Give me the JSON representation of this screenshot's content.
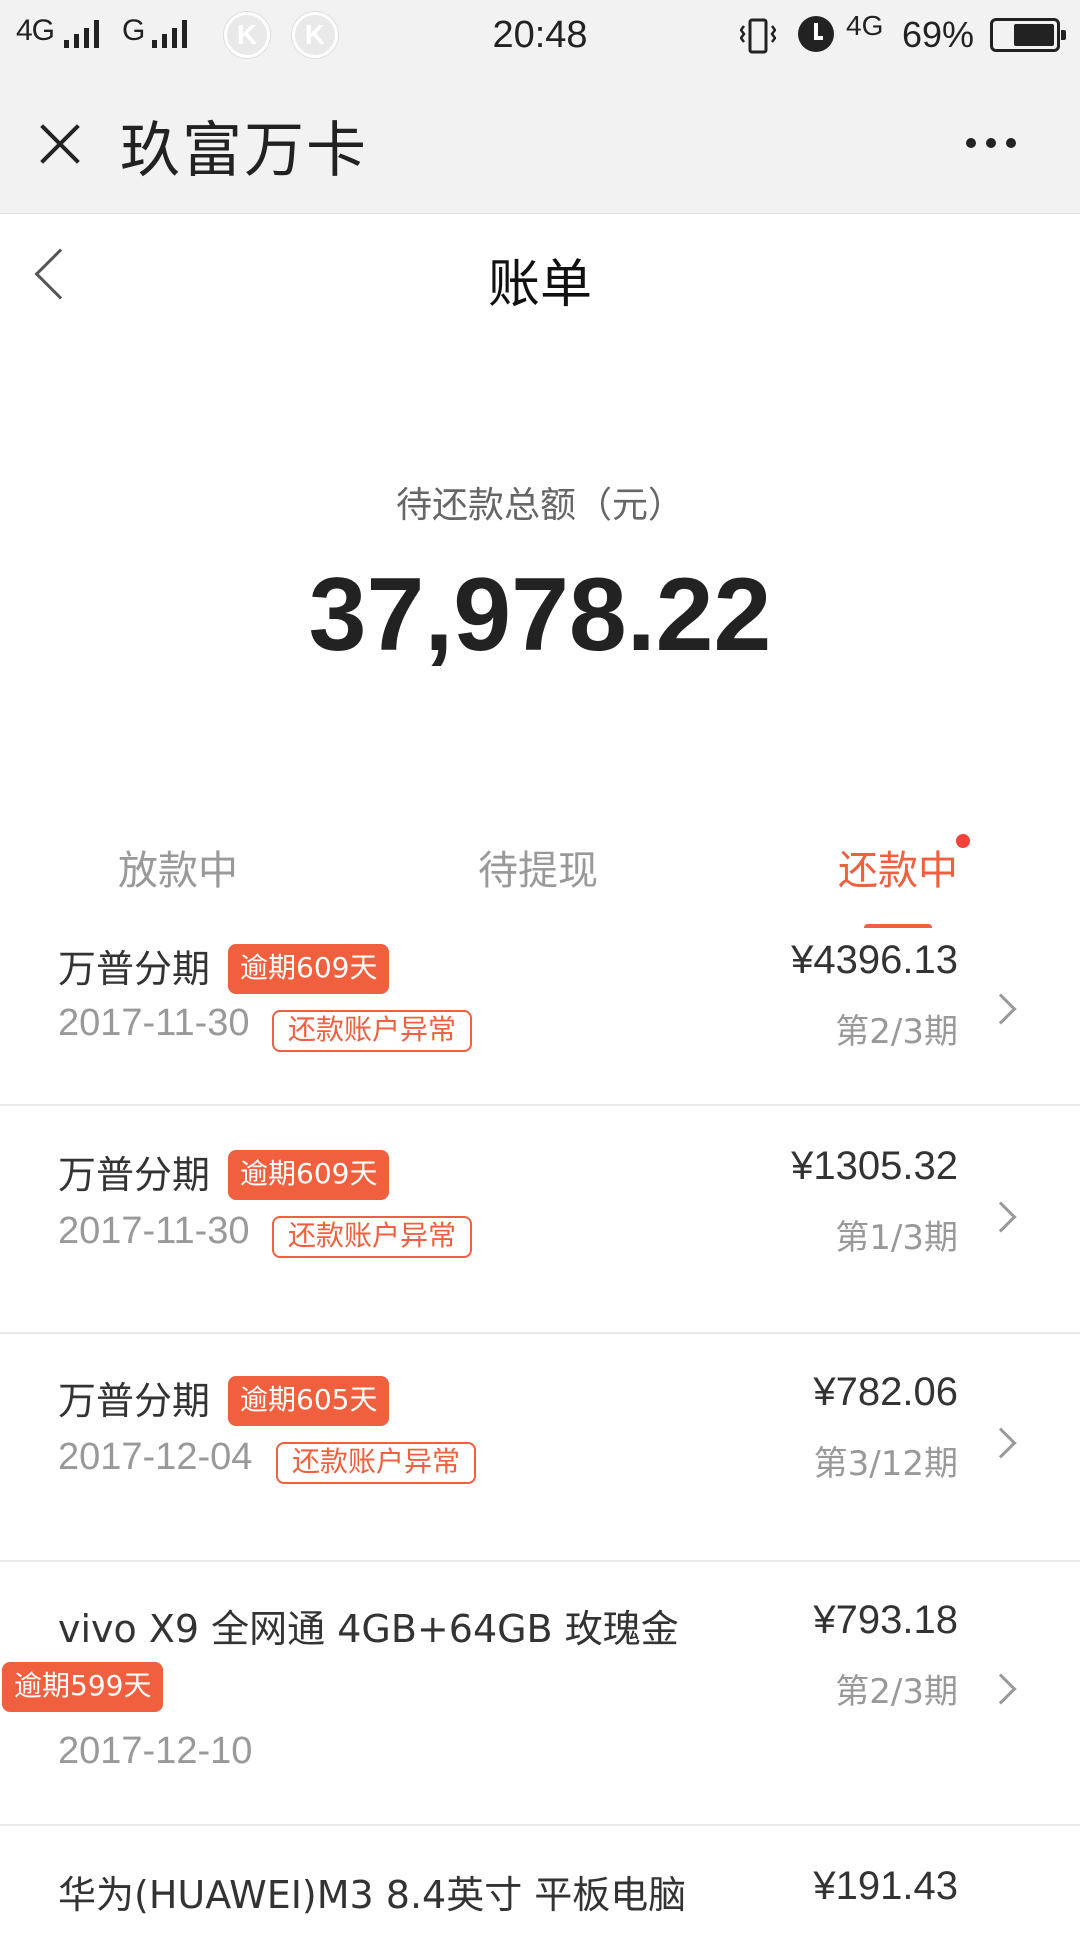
{
  "status_bar": {
    "network1": "4G",
    "network2": "G",
    "k_icon_label": "K",
    "time": "20:48",
    "data_type": "4G",
    "battery_percent": "69%",
    "battery_level": 0.69
  },
  "header": {
    "title": "玖富万卡"
  },
  "page": {
    "title": "账单"
  },
  "summary": {
    "label": "待还款总额（元）",
    "amount": "37,978.22"
  },
  "tabs": [
    {
      "label": "放款中"
    },
    {
      "label": "待提现"
    },
    {
      "label": "还款中"
    }
  ],
  "bills": [
    {
      "title": "万普分期",
      "overdue": "逾期609天",
      "date": "2017-11-30",
      "status": "还款账户异常",
      "amount": "¥4396.13",
      "period": "第2/3期"
    },
    {
      "title": "万普分期",
      "overdue": "逾期609天",
      "date": "2017-11-30",
      "status": "还款账户异常",
      "amount": "¥1305.32",
      "period": "第1/3期"
    },
    {
      "title": "万普分期",
      "overdue": "逾期605天",
      "date": "2017-12-04",
      "status": "还款账户异常",
      "amount": "¥782.06",
      "period": "第3/12期"
    },
    {
      "title": "vivo X9 全网通 4GB+64GB 玫瑰金",
      "overdue": "逾期599天",
      "date": "2017-12-10",
      "amount": "¥793.18",
      "period": "第2/3期"
    },
    {
      "title": "华为(HUAWEI)M3 8.4英寸 平板电脑",
      "amount": "¥191.43"
    }
  ]
}
